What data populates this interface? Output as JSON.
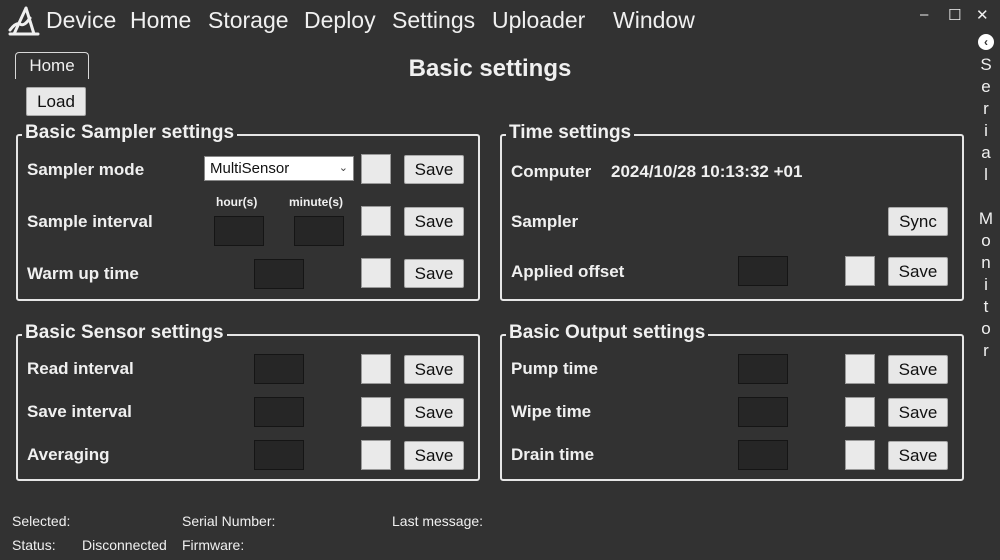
{
  "menu": [
    "Device",
    "Home",
    "Storage",
    "Deploy",
    "Settings",
    "Uploader",
    "Window"
  ],
  "window_controls": {
    "minimize": "–",
    "maximize": "☐",
    "close": "✕"
  },
  "side_panel": {
    "arrow": "‹",
    "label": "S\ne\nr\ni\na\nl\n \nM\no\nn\ni\nt\no\nr"
  },
  "tab_home": "Home",
  "page_title": "Basic settings",
  "load_button": "Load",
  "save_label": "Save",
  "sampler": {
    "title": "Basic Sampler settings",
    "mode_label": "Sampler mode",
    "mode_value": "MultiSensor",
    "interval_label": "Sample interval",
    "hours_label": "hour(s)",
    "minutes_label": "minute(s)",
    "warmup_label": "Warm up time"
  },
  "time": {
    "title": "Time settings",
    "computer_label": "Computer",
    "computer_value": "2024/10/28 10:13:32 +01",
    "sampler_label": "Sampler",
    "sync_label": "Sync",
    "offset_label": "Applied offset"
  },
  "sensor": {
    "title": "Basic Sensor settings",
    "read_label": "Read interval",
    "save_interval_label": "Save interval",
    "averaging_label": "Averaging"
  },
  "output": {
    "title": "Basic Output settings",
    "pump_label": "Pump time",
    "wipe_label": "Wipe time",
    "drain_label": "Drain time"
  },
  "status": {
    "selected_label": "Selected:",
    "serial_label": "Serial Number:",
    "last_message_label": "Last message:",
    "status_label": "Status:",
    "status_value": "Disconnected",
    "firmware_label": "Firmware:"
  }
}
